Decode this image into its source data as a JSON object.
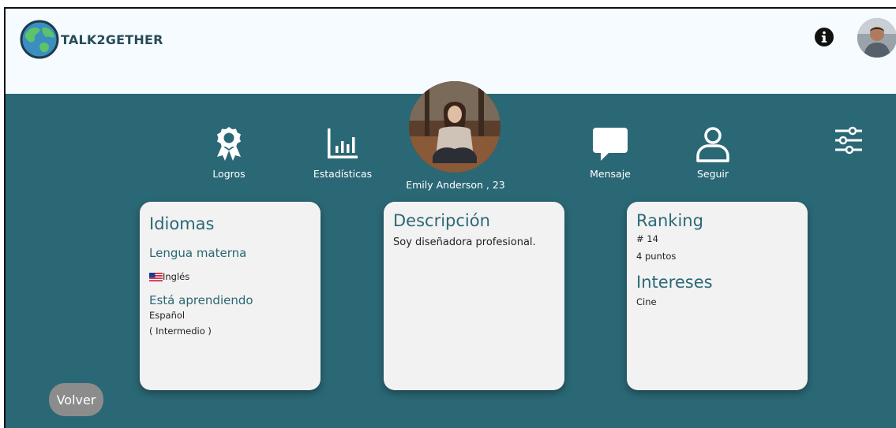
{
  "app": {
    "brand": "TALK2GETHER"
  },
  "header": {
    "info_icon": "info-icon",
    "user_avatar": "user-avatar"
  },
  "actions": {
    "achievements": {
      "label": "Logros",
      "icon": "award-icon"
    },
    "statistics": {
      "label": "Estadísticas",
      "icon": "bar-chart-icon"
    },
    "message": {
      "label": "Mensaje",
      "icon": "chat-bubble-icon"
    },
    "follow": {
      "label": "Seguir",
      "icon": "user-icon"
    },
    "settings": {
      "icon": "sliders-icon"
    }
  },
  "profile": {
    "name_age": "Emily Anderson , 23"
  },
  "languages_card": {
    "title": "Idiomas",
    "native_heading": "Lengua materna",
    "native_language": "Inglés",
    "learning_heading": "Está aprendiendo",
    "learning_language": "Español",
    "learning_level": "( Intermedio )"
  },
  "description_card": {
    "title": "Descripción",
    "text": "Soy diseñadora profesional."
  },
  "ranking_card": {
    "title": "Ranking",
    "rank": "# 14",
    "points": "4 puntos",
    "interests_title": "Intereses",
    "interests": "Cine"
  },
  "back_button": {
    "label": "Volver"
  },
  "colors": {
    "teal": "#2b6876",
    "card": "#f2f2f2",
    "header": "#f5fbff"
  }
}
